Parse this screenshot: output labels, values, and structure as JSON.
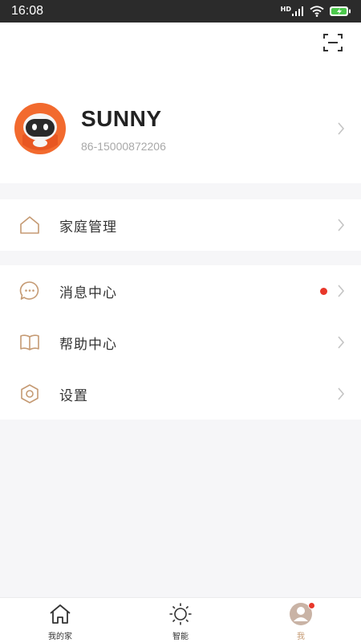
{
  "status_bar": {
    "time": "16:08",
    "network_label": "HD"
  },
  "profile": {
    "name": "SUNNY",
    "phone": "86-15000872206"
  },
  "menu_groups": [
    {
      "items": [
        {
          "label": "家庭管理",
          "icon": "home-outline-icon"
        }
      ]
    },
    {
      "items": [
        {
          "label": "消息中心",
          "icon": "chat-bubble-icon",
          "badge": true
        },
        {
          "label": "帮助中心",
          "icon": "open-book-icon"
        },
        {
          "label": "设置",
          "icon": "hexagon-settings-icon"
        }
      ]
    }
  ],
  "tabs": [
    {
      "label": "我的家",
      "icon": "home-icon",
      "active": false
    },
    {
      "label": "智能",
      "icon": "sun-icon",
      "active": false
    },
    {
      "label": "我",
      "icon": "user-avatar-icon",
      "active": true,
      "badge": true
    }
  ],
  "colors": {
    "accent": "#c59a73",
    "badge": "#e8372a",
    "avatar_orange": "#f26a2e"
  }
}
